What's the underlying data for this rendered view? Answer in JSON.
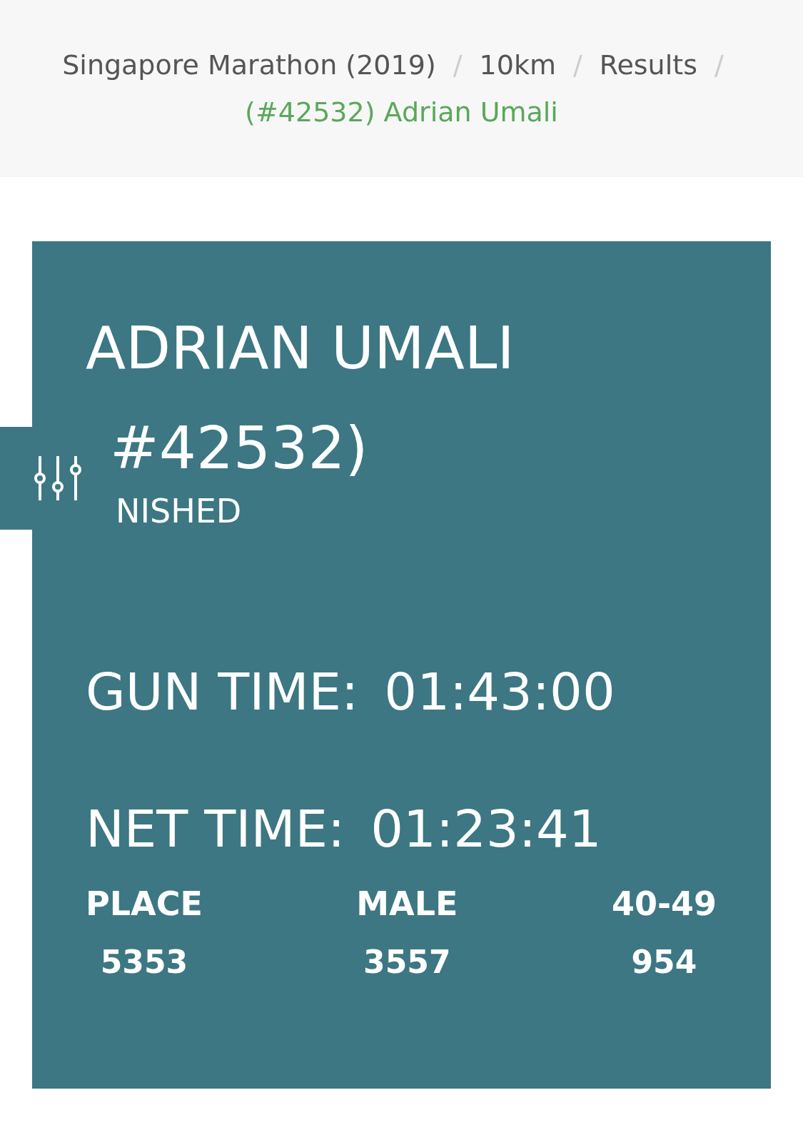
{
  "breadcrumb": [
    {
      "label": "Singapore Marathon (2019)",
      "separator": "/",
      "current": false
    },
    {
      "label": "10km",
      "separator": "/",
      "current": false
    },
    {
      "label": "Results",
      "separator": "/",
      "current": false
    },
    {
      "label": "(#42532) Adrian Umali",
      "current": true
    }
  ],
  "result": {
    "name": "ADRIAN UMALI",
    "bib": "#42532)",
    "status": "NISHED",
    "times": [
      {
        "label": "GUN TIME:",
        "value": "01:43:00"
      },
      {
        "label": "NET TIME:",
        "value": "01:23:41"
      }
    ],
    "ranks": [
      {
        "label": "PLACE",
        "value": "5353"
      },
      {
        "label": "MALE",
        "value": "3557"
      },
      {
        "label": "40-49",
        "value": "954"
      }
    ]
  }
}
